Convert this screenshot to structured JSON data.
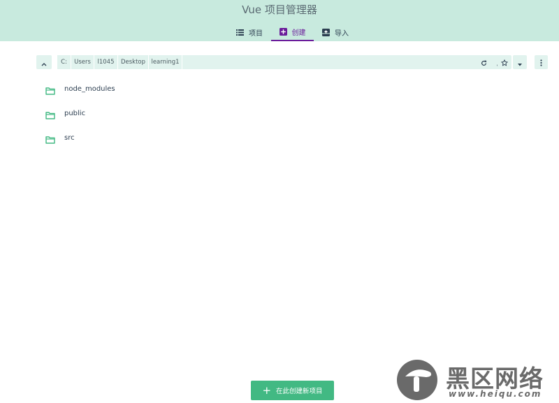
{
  "header": {
    "title": "Vue 项目管理器",
    "tabs": [
      {
        "label": "项目",
        "icon": "list-icon",
        "active": false
      },
      {
        "label": "创建",
        "icon": "add-box-icon",
        "active": true
      },
      {
        "label": "导入",
        "icon": "unarchive-icon",
        "active": false
      }
    ]
  },
  "toolbar": {
    "breadcrumbs": [
      "C:",
      "Users",
      "l1045",
      "Desktop",
      "learning1"
    ],
    "icons": [
      "chevron-up-icon",
      "edit-icon",
      "refresh-icon",
      "star-icon",
      "caret-down-icon",
      "more-vert-icon"
    ]
  },
  "folders": [
    {
      "name": "node_modules",
      "icon": "folder-icon"
    },
    {
      "name": "public",
      "icon": "folder-icon"
    },
    {
      "name": "src",
      "icon": "folder-icon"
    }
  ],
  "create_button": {
    "label": "在此创建新项目",
    "icon": "plus-icon"
  },
  "watermark": {
    "text": "黑区网络",
    "url": "www.heiqu.com"
  },
  "colors": {
    "header_bg": "#c8eade",
    "accent": "#42b983",
    "active_tab": "#6a1b9a",
    "toolbar_bg": "#e1f3ee"
  }
}
